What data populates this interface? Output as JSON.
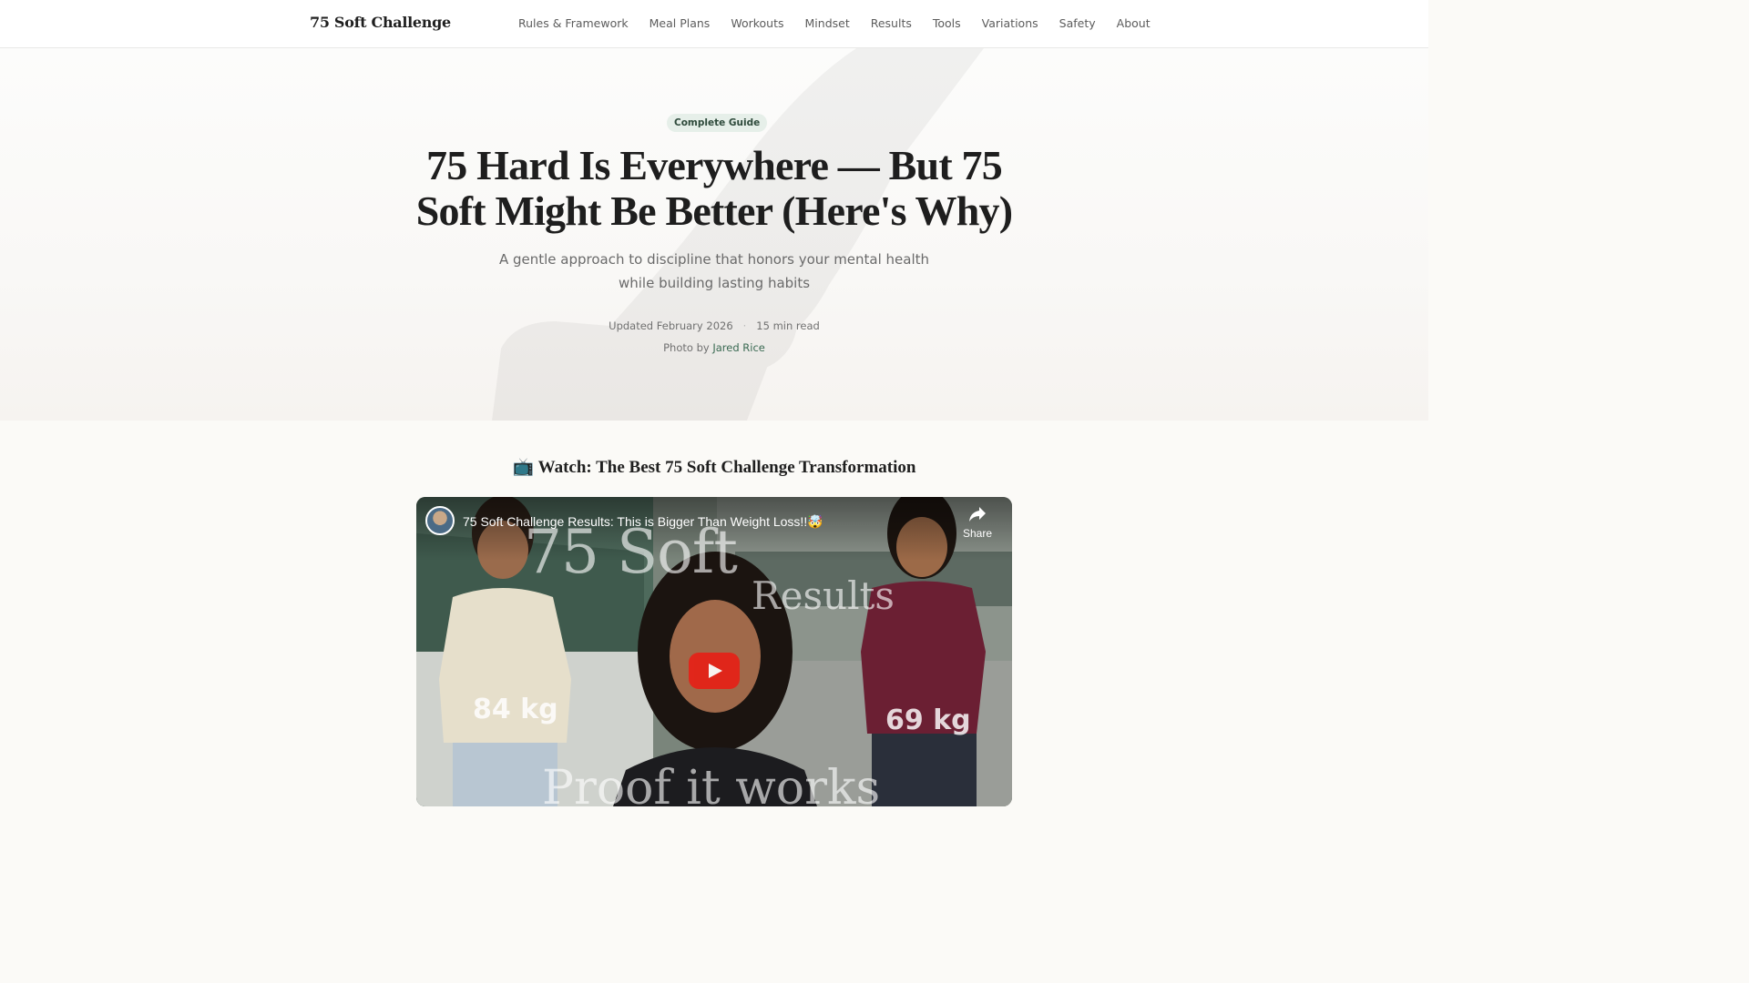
{
  "brand": "75 Soft Challenge",
  "nav": [
    "Rules & Framework",
    "Meal Plans",
    "Workouts",
    "Mindset",
    "Results",
    "Tools",
    "Variations",
    "Safety",
    "About"
  ],
  "hero": {
    "badge": "Complete Guide",
    "title": "75 Hard Is Everywhere — But 75 Soft Might Be Better (Here's Why)",
    "subtitle": "A gentle approach to discipline that honors your mental health while building lasting habits",
    "updated": "Updated February 2026",
    "read_time": "15 min read",
    "photo_prefix": "Photo by",
    "photo_credit": "Jared Rice"
  },
  "watch": {
    "heading": "📺 Watch: The Best 75 Soft Challenge Transformation",
    "video_title": "75 Soft Challenge Results: This is Bigger Than Weight Loss!!🤯",
    "share": "Share",
    "thumb_title": "75 Soft",
    "thumb_sub": "Results",
    "thumb_bottom": "Proof it works",
    "before_weight": "84 kg",
    "after_weight": "69 kg"
  },
  "colors": {
    "accent": "#3a6a52",
    "badge_bg": "#e6efe9",
    "play": "#e62117"
  },
  "icons": [
    "share-icon",
    "play-icon",
    "tv-icon"
  ]
}
